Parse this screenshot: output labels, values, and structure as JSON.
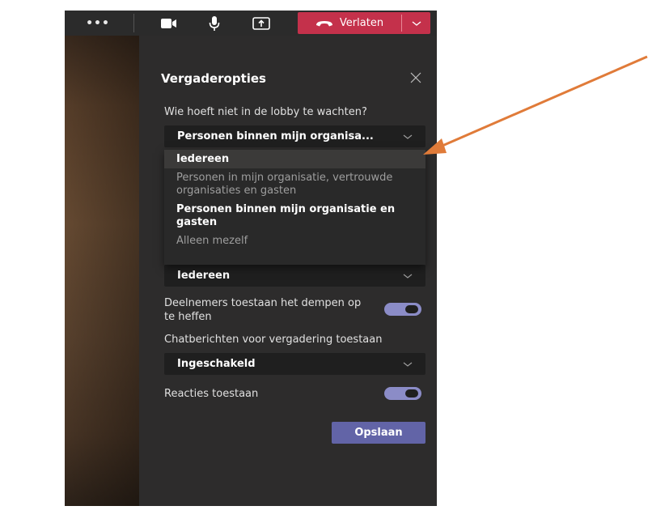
{
  "toolbar": {
    "more_label": "•••",
    "leave_label": "Verlaten",
    "icons": [
      "more-icon",
      "camera-icon",
      "microphone-icon",
      "share-icon",
      "phone-hangup-icon",
      "chevron-down-icon"
    ],
    "leave_color": "#c4314b"
  },
  "panel": {
    "title": "Vergaderopties",
    "lobby_question": "Wie hoeft niet in de lobby te wachten?",
    "lobby_selected": "Personen binnen mijn organisa...",
    "lobby_options": [
      "Iedereen",
      "Personen in mijn organisatie, vertrouwde organisaties en gasten",
      "Personen binnen mijn organisatie en gasten",
      "Alleen mezelf"
    ],
    "presenter_selected": "Iedereen",
    "unmute_label": "Deelnemers toestaan het dempen op te heffen",
    "unmute_on": true,
    "chat_label": "Chatberichten voor vergadering toestaan",
    "chat_selected": "Ingeschakeld",
    "reactions_label": "Reacties toestaan",
    "reactions_on": true,
    "save_label": "Opslaan",
    "accent_color": "#6264a7",
    "toggle_color": "#8b8cc7"
  },
  "annotation": {
    "arrow_color": "#e07b39"
  }
}
